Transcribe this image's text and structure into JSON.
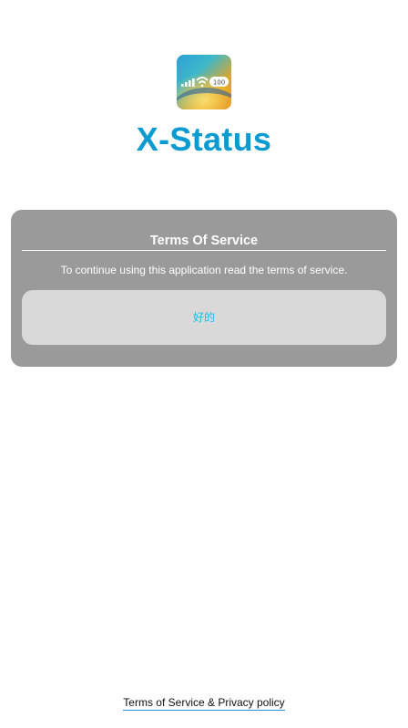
{
  "app": {
    "icon_name": "signal-status-app-icon",
    "icon_badge": "100",
    "title": "X-Status",
    "title_color": "#0a9bd1"
  },
  "dialog": {
    "title": "Terms Of Service",
    "message": "To continue using this application read the terms of service.",
    "ok_label": "好的",
    "background_color": "#9a9a9a",
    "button_color": "#d9d9d9",
    "button_text_color": "#14c0ea"
  },
  "footer": {
    "link_label": "Terms of Service & Privacy policy"
  }
}
